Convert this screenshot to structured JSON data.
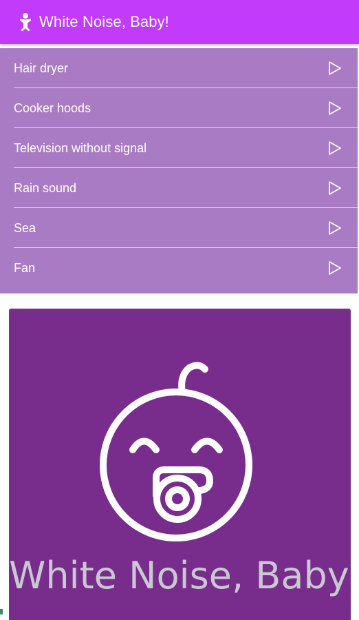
{
  "app_bar": {
    "title": "White Noise, Baby!",
    "background": "#c23bfa",
    "logo_icon": "baby-icon"
  },
  "sounds": {
    "background": "#a97bc4",
    "items": [
      {
        "label": "Hair dryer",
        "icon": "play-icon"
      },
      {
        "label": "Cooker hoods",
        "icon": "play-icon"
      },
      {
        "label": "Television without signal",
        "icon": "play-icon"
      },
      {
        "label": "Rain sound",
        "icon": "play-icon"
      },
      {
        "label": "Sea",
        "icon": "play-icon"
      },
      {
        "label": "Fan",
        "icon": "play-icon"
      }
    ]
  },
  "banner": {
    "title": "White Noise, Baby!",
    "background": "#782c8c",
    "icon": "baby-pacifier-icon"
  }
}
